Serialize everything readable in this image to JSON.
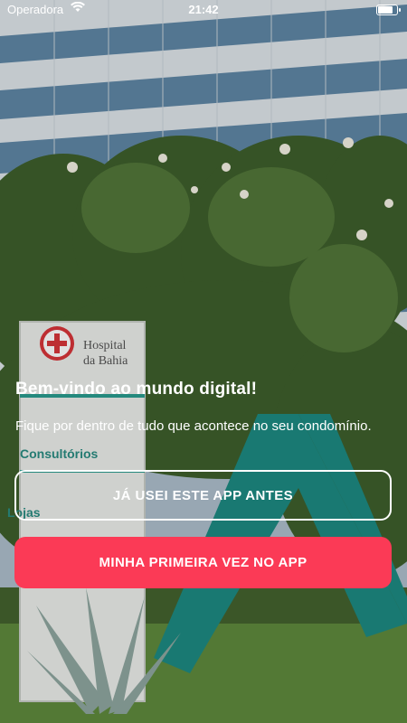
{
  "status_bar": {
    "carrier": "Operadora",
    "time": "21:42"
  },
  "background": {
    "sign_name": "Hospital da Bahia",
    "sign_lines": [
      "Consultórios",
      "Lojas"
    ]
  },
  "welcome": {
    "title": "Bem-vindo ao mundo digital!",
    "subtitle": "Fique por dentro de tudo que acontece no seu condomínio."
  },
  "buttons": {
    "returning_user": "JÁ USEI ESTE APP ANTES",
    "first_time": "MINHA PRIMEIRA VEZ NO APP"
  },
  "colors": {
    "accent": "#fb3a56",
    "text": "#ffffff"
  }
}
